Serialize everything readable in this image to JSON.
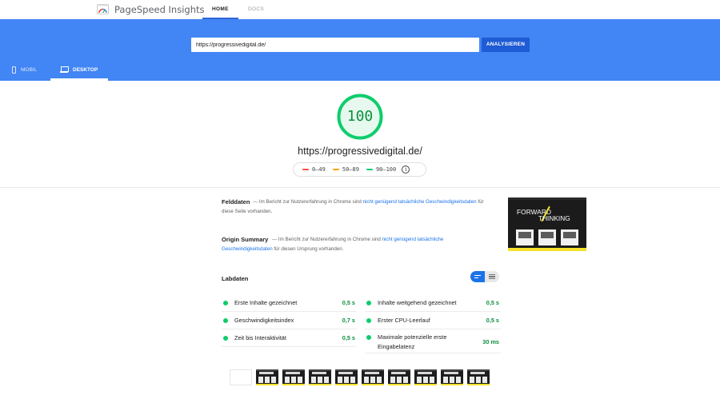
{
  "app": {
    "name": "PageSpeed Insights",
    "nav": [
      {
        "label": "HOME",
        "active": true
      },
      {
        "label": "DOCS",
        "active": false
      }
    ]
  },
  "search": {
    "url_value": "https://progressivedigital.de/",
    "button_label": "ANALYSIEREN"
  },
  "device_tabs": [
    {
      "label": "MOBIL",
      "icon": "phone-icon",
      "active": false
    },
    {
      "label": "DESKTOP",
      "icon": "laptop-icon",
      "active": true
    }
  ],
  "summary": {
    "score": "100",
    "score_fraction": 1.0,
    "url": "https://progressivedigital.de/",
    "legend": [
      {
        "range": "0–49",
        "color": "#ff4e42"
      },
      {
        "range": "50–89",
        "color": "#ffa400"
      },
      {
        "range": "90–100",
        "color": "#0cce6b"
      }
    ]
  },
  "field_data": {
    "title": "Felddaten",
    "text_pre": "Im Bericht zur Nutzererfahrung in Chrome sind",
    "link": "nicht genügend tatsächliche Geschwindigkeitsdaten",
    "text_post": "für diese Seite vorhanden."
  },
  "origin_summary": {
    "title": "Origin Summary",
    "text_pre": "Im Bericht zur Nutzererfahrung in Chrome sind",
    "link": "nicht genügend tatsächliche Geschwindigkeitsdaten",
    "text_post": "für diesen Ursprung vorhanden."
  },
  "screenshot": {
    "line1": "FORWARD",
    "line2": "THINKING"
  },
  "lab_data": {
    "title": "Labdaten",
    "metrics": [
      {
        "label": "Erste Inhalte gezeichnet",
        "value": "0,5 s"
      },
      {
        "label": "Inhalte weitgehend gezeichnet",
        "value": "0,5 s"
      },
      {
        "label": "Geschwindigkeitsindex",
        "value": "0,7 s"
      },
      {
        "label": "Erster CPU-Leerlauf",
        "value": "0,5 s"
      },
      {
        "label": "Zeit bis Interaktivität",
        "value": "0,5 s"
      },
      {
        "label": "Maximale potenzielle erste Eingabelatenz",
        "value": "30 ms"
      }
    ]
  },
  "colors": {
    "brand_blue": "#4285f4",
    "button_blue": "#1e5bd4",
    "pass_green": "#0cce6b",
    "link_blue": "#1a73e8"
  }
}
